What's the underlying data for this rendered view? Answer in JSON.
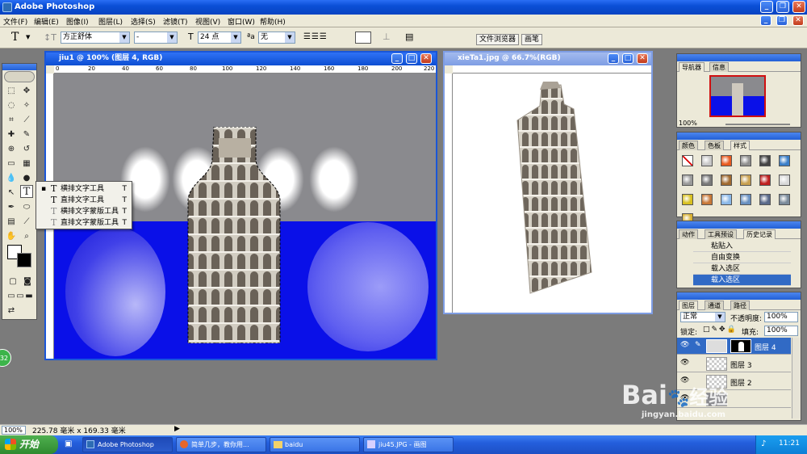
{
  "app": {
    "title": "Adobe Photoshop"
  },
  "menu": [
    "文件(F)",
    "编辑(E)",
    "图像(I)",
    "图层(L)",
    "选择(S)",
    "滤镜(T)",
    "视图(V)",
    "窗口(W)",
    "帮助(H)"
  ],
  "options": {
    "tool_glyph": "T",
    "font_family": "方正舒体",
    "font_style": "-",
    "font_size": "24 点",
    "aa_label": "ªa",
    "antialias": "无",
    "file_browser": "文件浏览器",
    "brush": "画笔"
  },
  "doc1": {
    "title": "jiu1 @ 100% (图层 4, RGB)",
    "ruler": [
      "0",
      "20",
      "40",
      "60",
      "80",
      "100",
      "120",
      "140",
      "160",
      "180",
      "200",
      "220"
    ]
  },
  "doc2": {
    "title": "xieTa1.jpg @ 66.7%(RGB)"
  },
  "flyout": {
    "items": [
      {
        "label": "横排文字工具",
        "key": "T"
      },
      {
        "label": "直排文字工具",
        "key": "T"
      },
      {
        "label": "横排文字蒙版工具",
        "key": "T"
      },
      {
        "label": "直排文字蒙版工具",
        "key": "T"
      }
    ]
  },
  "navigator": {
    "tabs": [
      "导航器",
      "信息"
    ],
    "zoom": "100%"
  },
  "swatches_panel": {
    "tabs": [
      "颜色",
      "色板",
      "样式"
    ],
    "colors": [
      "#c8c8c8",
      "#e85a20",
      "#8f8f8f",
      "#444444",
      "#3a7ec8",
      "#9a9a9a",
      "#7a7a7a",
      "#a06a30",
      "#c8a050",
      "#c02020",
      "#d8d8d8",
      "#d8c020",
      "#c87838",
      "#8ab8e8",
      "#6890c0",
      "#5a6a8a",
      "#7a8a9a",
      "#d8b030"
    ]
  },
  "history": {
    "tabs": [
      "动作",
      "工具预设",
      "历史记录"
    ],
    "items": [
      "粘贴入",
      "自由变换",
      "载入选区",
      "载入选区"
    ]
  },
  "layers": {
    "tabs": [
      "图层",
      "通道",
      "路径"
    ],
    "blend_mode": "正常",
    "opacity_label": "不透明度:",
    "opacity": "100%",
    "lock_label": "锁定:",
    "fill_label": "填充:",
    "fill": "100%",
    "items": [
      "图层 4",
      "图层 3",
      "图层 2"
    ]
  },
  "status": {
    "zoom": "100%",
    "info": "225.78 毫米 x 169.33 毫米"
  },
  "taskbar": {
    "start": "开始",
    "items": [
      "Adobe Photoshop",
      "简单几步，教你用...",
      "baidu",
      "jiu45.JPG - 画图"
    ],
    "time": "11:21"
  },
  "watermark": {
    "logo": "Bai",
    "suffix": "经验",
    "url": "jingyan.baidu.com"
  },
  "badge": "32",
  "colors": {
    "canvas_blue": "#0a10e8",
    "title_blue": "#0d4ed2",
    "highlight": "#316ac5"
  }
}
